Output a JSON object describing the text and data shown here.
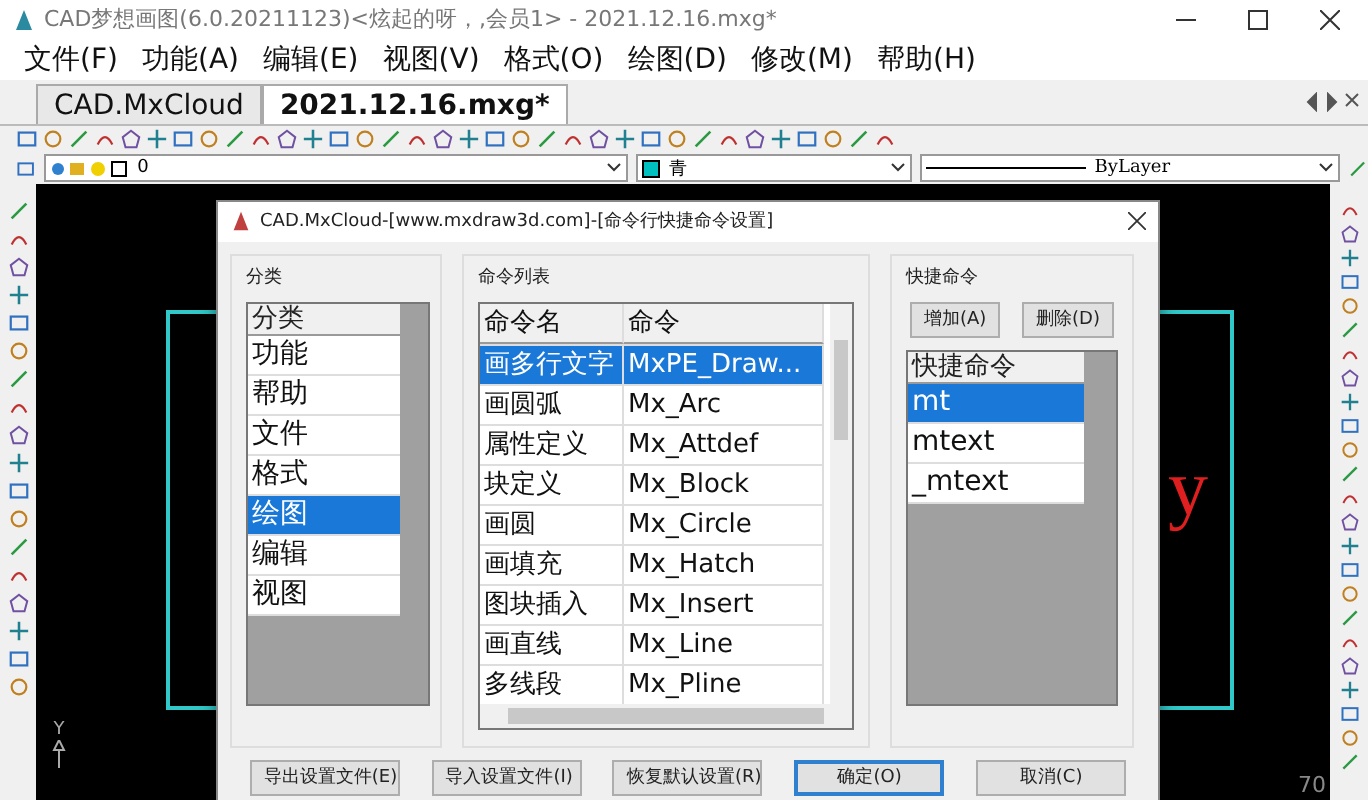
{
  "window": {
    "title": "CAD梦想画图(6.0.20211123)<炫起的呀，,会员1> - 2021.12.16.mxg*"
  },
  "menu": [
    {
      "label": "文件(F)"
    },
    {
      "label": "功能(A)"
    },
    {
      "label": "编辑(E)"
    },
    {
      "label": "视图(V)"
    },
    {
      "label": "格式(O)"
    },
    {
      "label": "绘图(D)"
    },
    {
      "label": "修改(M)"
    },
    {
      "label": "帮助(H)"
    }
  ],
  "tabs": [
    {
      "label": "CAD.MxCloud",
      "selected": false
    },
    {
      "label": "2021.12.16.mxg*",
      "selected": true
    }
  ],
  "layer_bar": {
    "layer": "0",
    "color_name": "青",
    "linetype": "ByLayer"
  },
  "canvas": {
    "text": "y",
    "axis_label": "Y",
    "coordinate": "70"
  },
  "dialog": {
    "title": "CAD.MxCloud-[www.mxdraw3d.com]-[命令行快捷命令设置]",
    "category": {
      "label": "分类",
      "header": "分类",
      "items": [
        {
          "label": "功能",
          "selected": false
        },
        {
          "label": "帮助",
          "selected": false
        },
        {
          "label": "文件",
          "selected": false
        },
        {
          "label": "格式",
          "selected": false
        },
        {
          "label": "绘图",
          "selected": true
        },
        {
          "label": "编辑",
          "selected": false
        },
        {
          "label": "视图",
          "selected": false
        }
      ]
    },
    "commands": {
      "label": "命令列表",
      "columns": [
        "命令名",
        "命令"
      ],
      "rows": [
        {
          "name": "画多行文字",
          "command": "MxPE_Draw...",
          "selected": true
        },
        {
          "name": "画圆弧",
          "command": "Mx_Arc",
          "selected": false
        },
        {
          "name": "属性定义",
          "command": "Mx_Attdef",
          "selected": false
        },
        {
          "name": "块定义",
          "command": "Mx_Block",
          "selected": false
        },
        {
          "name": "画圆",
          "command": "Mx_Circle",
          "selected": false
        },
        {
          "name": "画填充",
          "command": "Mx_Hatch",
          "selected": false
        },
        {
          "name": "图块插入",
          "command": "Mx_Insert",
          "selected": false
        },
        {
          "name": "画直线",
          "command": "Mx_Line",
          "selected": false
        },
        {
          "name": "多线段",
          "command": "Mx_Pline",
          "selected": false
        }
      ]
    },
    "shortcuts": {
      "label": "快捷命令",
      "buttons": [
        "增加(A)",
        "删除(D)"
      ],
      "header": "快捷命令",
      "items": [
        {
          "label": "mt",
          "selected": true
        },
        {
          "label": "mtext",
          "selected": false
        },
        {
          "label": "_mtext",
          "selected": false
        }
      ]
    },
    "buttons": [
      {
        "label": "导出设置文件(E)",
        "default": false
      },
      {
        "label": "导入设置文件(I)",
        "default": false
      },
      {
        "label": "恢复默认设置(R)",
        "default": false
      },
      {
        "label": "确定(O)",
        "default": true
      },
      {
        "label": "取消(C)",
        "default": false
      }
    ]
  }
}
